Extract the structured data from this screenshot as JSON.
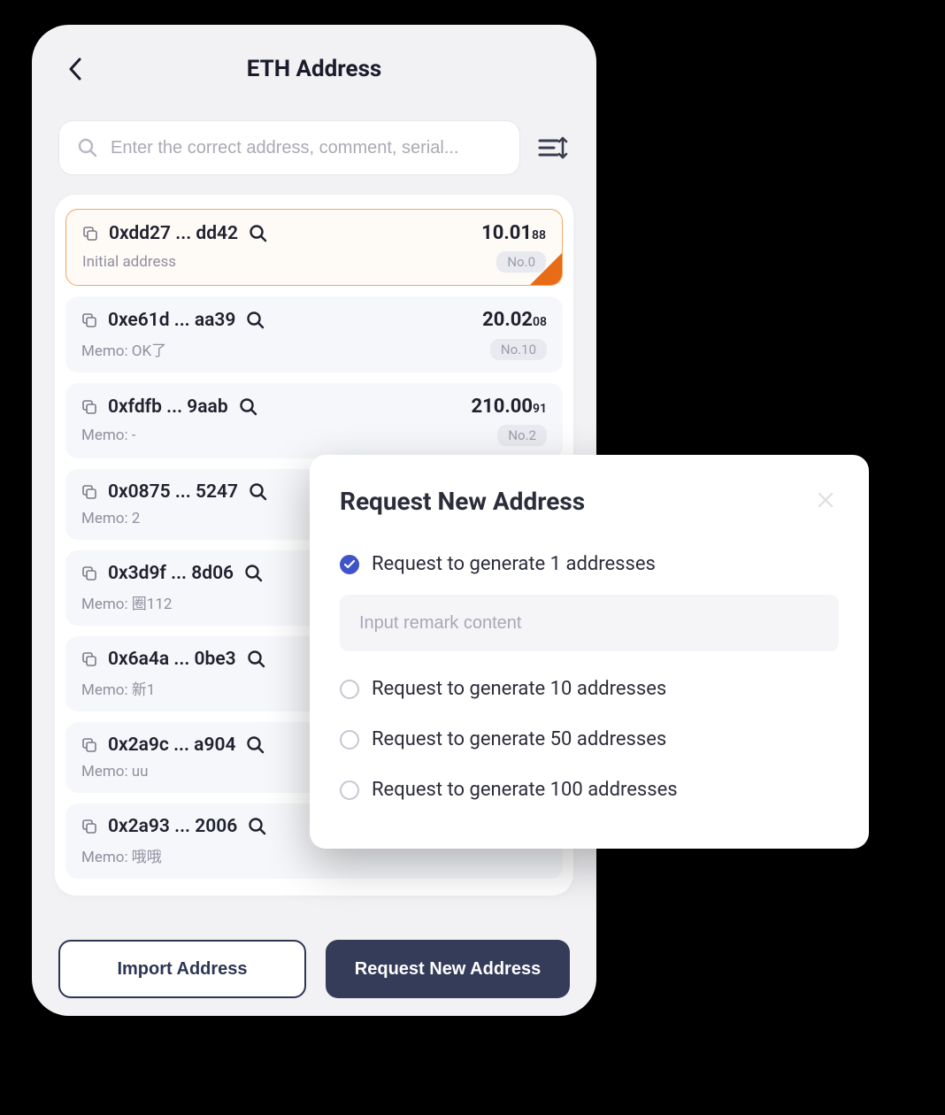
{
  "header": {
    "title": "ETH Address"
  },
  "search": {
    "placeholder": "Enter the correct address, comment, serial..."
  },
  "addresses": [
    {
      "addr": "0xdd27 ... dd42",
      "balance_int": "10.01",
      "balance_dec": "88",
      "memo": "Initial address",
      "no": "No.0",
      "selected": true
    },
    {
      "addr": "0xe61d ... aa39",
      "balance_int": "20.02",
      "balance_dec": "08",
      "memo": "Memo: OK了",
      "no": "No.10",
      "selected": false
    },
    {
      "addr": "0xfdfb ... 9aab",
      "balance_int": "210.00",
      "balance_dec": "91",
      "memo": "Memo: -",
      "no": "No.2",
      "selected": false
    },
    {
      "addr": "0x0875 ... 5247",
      "balance_int": "",
      "balance_dec": "",
      "memo": "Memo: 2",
      "no": "",
      "selected": false
    },
    {
      "addr": "0x3d9f ... 8d06",
      "balance_int": "",
      "balance_dec": "",
      "memo": "Memo: 圈112",
      "no": "",
      "selected": false
    },
    {
      "addr": "0x6a4a ... 0be3",
      "balance_int": "",
      "balance_dec": "",
      "memo": "Memo: 新1",
      "no": "",
      "selected": false
    },
    {
      "addr": "0x2a9c ... a904",
      "balance_int": "",
      "balance_dec": "",
      "memo": "Memo: uu",
      "no": "",
      "selected": false
    },
    {
      "addr": "0x2a93 ... 2006",
      "balance_int": "",
      "balance_dec": "",
      "memo": "Memo: 哦哦",
      "no": "",
      "selected": false
    }
  ],
  "footer": {
    "import_label": "Import Address",
    "request_label": "Request New Address"
  },
  "modal": {
    "title": "Request New Address",
    "remark_placeholder": "Input remark content",
    "options": [
      {
        "label": "Request to generate 1 addresses",
        "checked": true
      },
      {
        "label": "Request to generate 10 addresses",
        "checked": false
      },
      {
        "label": "Request to generate 50 addresses",
        "checked": false
      },
      {
        "label": "Request to generate 100 addresses",
        "checked": false
      }
    ]
  }
}
